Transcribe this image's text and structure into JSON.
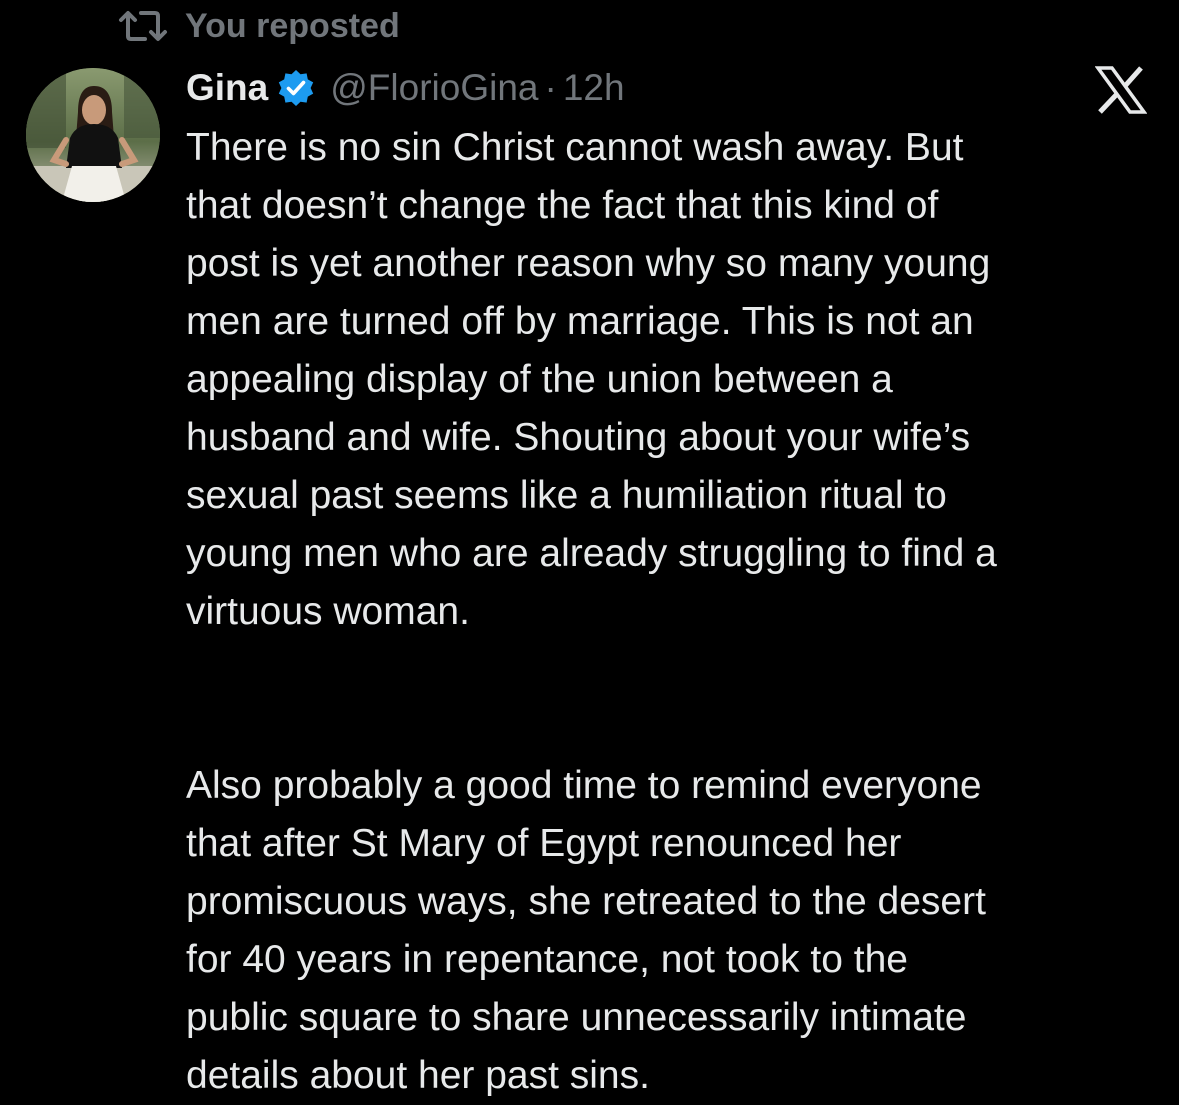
{
  "repost_banner": {
    "icon": "repost-icon",
    "text": "You reposted"
  },
  "author": {
    "avatar": "avatar",
    "name": "Gina",
    "verified_icon": "verified-badge-icon",
    "handle": "@FlorioGina",
    "separator": "·",
    "time": "12h"
  },
  "brand_icon": "x-logo-icon",
  "tweet": {
    "paragraphs": [
      {
        "lines": [
          "There is no sin Christ cannot wash away. But",
          "that doesn’t change the fact that this kind of",
          "post is yet another reason why so many young",
          "men are turned off by marriage. This is not an",
          "appealing display of the union between a",
          "husband and wife. Shouting about your wife’s",
          "sexual past seems like a humiliation ritual to",
          "young men who are already struggling to find a",
          "virtuous woman."
        ]
      },
      {
        "lines": [
          "Also probably a good time to remind everyone",
          "that after St Mary of Egypt renounced her",
          "promiscuous ways, she retreated to the desert",
          "for 40 years in repentance, not took to the",
          "public square to share unnecessarily intimate",
          "details about her past sins."
        ]
      }
    ]
  },
  "colors": {
    "background": "#000000",
    "text_primary": "#e7e9ea",
    "text_secondary": "#71767b",
    "verified_blue": "#1d9bf0"
  }
}
